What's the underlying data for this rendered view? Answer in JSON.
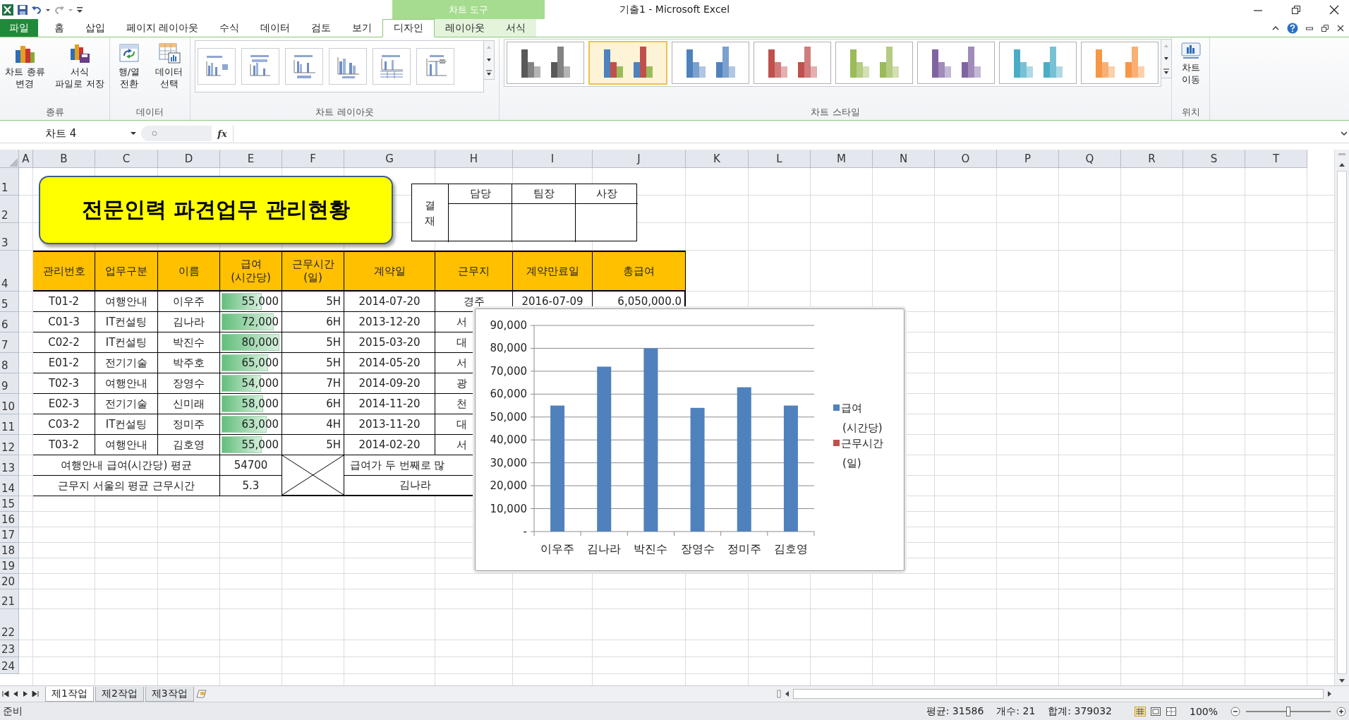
{
  "window": {
    "title": "기출1 - Microsoft Excel"
  },
  "context_group": "차트 도구",
  "tabs": [
    {
      "label": "파일",
      "kind": "file",
      "selected": false
    },
    {
      "label": "홈",
      "kind": "normal",
      "selected": false
    },
    {
      "label": "삽입",
      "kind": "normal",
      "selected": false
    },
    {
      "label": "페이지 레이아웃",
      "kind": "normal",
      "selected": false
    },
    {
      "label": "수식",
      "kind": "normal",
      "selected": false
    },
    {
      "label": "데이터",
      "kind": "normal",
      "selected": false
    },
    {
      "label": "검토",
      "kind": "normal",
      "selected": false
    },
    {
      "label": "보기",
      "kind": "normal",
      "selected": false
    },
    {
      "label": "디자인",
      "kind": "context",
      "selected": true
    },
    {
      "label": "레이아웃",
      "kind": "context",
      "selected": false
    },
    {
      "label": "서식",
      "kind": "context",
      "selected": false
    }
  ],
  "ribbon": {
    "type_group": {
      "label": "종류",
      "buttons": [
        {
          "label": "차트 종류\n변경",
          "kind": "change-type"
        },
        {
          "label": "서식\n파일로 저장",
          "kind": "save-template"
        }
      ]
    },
    "data_group": {
      "label": "데이터",
      "buttons": [
        {
          "label": "행/열\n전환",
          "kind": "switch"
        },
        {
          "label": "데이터\n선택",
          "kind": "select-data"
        }
      ]
    },
    "layouts_label": "차트 레이아웃",
    "layouts": [
      {
        "kind": "legend-right",
        "selected": false
      },
      {
        "kind": "title-legend",
        "selected": false
      },
      {
        "kind": "legend-bottom",
        "selected": false
      },
      {
        "kind": "plain",
        "selected": false
      },
      {
        "kind": "table",
        "selected": false
      },
      {
        "kind": "lines",
        "selected": false
      }
    ],
    "styles_label": "차트 스타일",
    "styles": [
      {
        "kind": "mono",
        "color": "#595959",
        "selected": false
      },
      {
        "kind": "multi",
        "color": "#4f81bd",
        "selected": true
      },
      {
        "kind": "mono",
        "color": "#4f81bd",
        "selected": false
      },
      {
        "kind": "mono",
        "color": "#c0504d",
        "selected": false
      },
      {
        "kind": "mono",
        "color": "#9bbb59",
        "selected": false
      },
      {
        "kind": "mono",
        "color": "#8064a2",
        "selected": false
      },
      {
        "kind": "mono",
        "color": "#4bacc6",
        "selected": false
      },
      {
        "kind": "mono",
        "color": "#f79646",
        "selected": false
      }
    ],
    "location_group": {
      "label": "위치",
      "button": "차트\n이동"
    }
  },
  "name_box": "차트 4",
  "formula_label": "fx",
  "columns": [
    "A",
    "B",
    "C",
    "D",
    "E",
    "F",
    "G",
    "H",
    "I",
    "J",
    "K",
    "L",
    "M",
    "N",
    "O",
    "P",
    "Q",
    "R",
    "S",
    "T"
  ],
  "row_numbers": [
    "1",
    "2",
    "3",
    "4",
    "5",
    "6",
    "7",
    "8",
    "9",
    "10",
    "11",
    "12",
    "13",
    "14",
    "15",
    "16",
    "17",
    "18",
    "19",
    "20",
    "21",
    "22",
    "23",
    "24"
  ],
  "title_shape": "전문인력 파견업무 관리현황",
  "approval": {
    "side_label": "결\n재",
    "roles": [
      "담당",
      "팀장",
      "사장"
    ]
  },
  "table": {
    "columns": [
      "관리번호",
      "업무구분",
      "이름",
      "급여\n(시간당)",
      "근무시간\n(일)",
      "계약일",
      "근무지",
      "계약만료일",
      "총급여"
    ],
    "rows": [
      {
        "cells": [
          "T01-2",
          "여행안내",
          "이우주",
          "55,000",
          "5H",
          "2014-07-20",
          "경주",
          "2016-07-09",
          "6,050,000.0"
        ],
        "level": 0.65
      },
      {
        "cells": [
          "C01-3",
          "IT컨설팅",
          "김나라",
          "72,000",
          "6H",
          "2013-12-20",
          "서"
        ],
        "level": 0.85
      },
      {
        "cells": [
          "C02-2",
          "IT컨설팅",
          "박진수",
          "80,000",
          "5H",
          "2015-03-20",
          "대"
        ],
        "level": 0.94
      },
      {
        "cells": [
          "E01-2",
          "전기기술",
          "박주호",
          "65,000",
          "5H",
          "2014-05-20",
          "서"
        ],
        "level": 0.76
      },
      {
        "cells": [
          "T02-3",
          "여행안내",
          "장영수",
          "54,000",
          "7H",
          "2014-09-20",
          "광"
        ],
        "level": 0.64
      },
      {
        "cells": [
          "E02-3",
          "전기기술",
          "신미래",
          "58,000",
          "6H",
          "2014-11-20",
          "천"
        ],
        "level": 0.68
      },
      {
        "cells": [
          "C03-2",
          "IT컨설팅",
          "정미주",
          "63,000",
          "4H",
          "2013-11-20",
          "대"
        ],
        "level": 0.74
      },
      {
        "cells": [
          "T03-2",
          "여행안내",
          "김호영",
          "55,000",
          "5H",
          "2014-02-20",
          "서"
        ],
        "level": 0.65
      }
    ],
    "summary": [
      {
        "label": "여행안내 급여(시간당) 평균",
        "value": "54700"
      },
      {
        "label": "근무지 서울의 평균 근무시간",
        "value": "5.3"
      }
    ],
    "question": "급여가 두 번째로 많",
    "answer": "김나라"
  },
  "chart": {
    "chart_data": {
      "type": "bar",
      "categories": [
        "이우주",
        "김나라",
        "박진수",
        "장영수",
        "정미주",
        "김호영"
      ],
      "series": [
        {
          "name": "급여\n(시간당)",
          "color": "#4f81bd",
          "values": [
            55000,
            72000,
            80000,
            54000,
            63000,
            55000
          ]
        },
        {
          "name": "근무시간\n(일)",
          "color": "#c0504d",
          "values": [
            null,
            null,
            null,
            null,
            null,
            null
          ]
        }
      ],
      "grid": true,
      "ylim": [
        0,
        90000
      ],
      "yticks": [
        {
          "value": 0,
          "label": "-"
        },
        {
          "value": 10000,
          "label": "10,000"
        },
        {
          "value": 20000,
          "label": "20,000"
        },
        {
          "value": 30000,
          "label": "30,000"
        },
        {
          "value": 40000,
          "label": "40,000"
        },
        {
          "value": 50000,
          "label": "50,000"
        },
        {
          "value": 60000,
          "label": "60,000"
        },
        {
          "value": 70000,
          "label": "70,000"
        },
        {
          "value": 80000,
          "label": "80,000"
        },
        {
          "value": 90000,
          "label": "90,000"
        }
      ]
    }
  },
  "sheet_tabs": [
    {
      "label": "제1작업",
      "selected": true
    },
    {
      "label": "제2작업",
      "selected": false
    },
    {
      "label": "제3작업",
      "selected": false
    }
  ],
  "status_bar": {
    "mode": "준비",
    "average": "평균: 31586",
    "count": "개수: 21",
    "sum": "합계: 379032",
    "zoom": "100%",
    "zoom_slider": {
      "level": 0.5
    }
  }
}
